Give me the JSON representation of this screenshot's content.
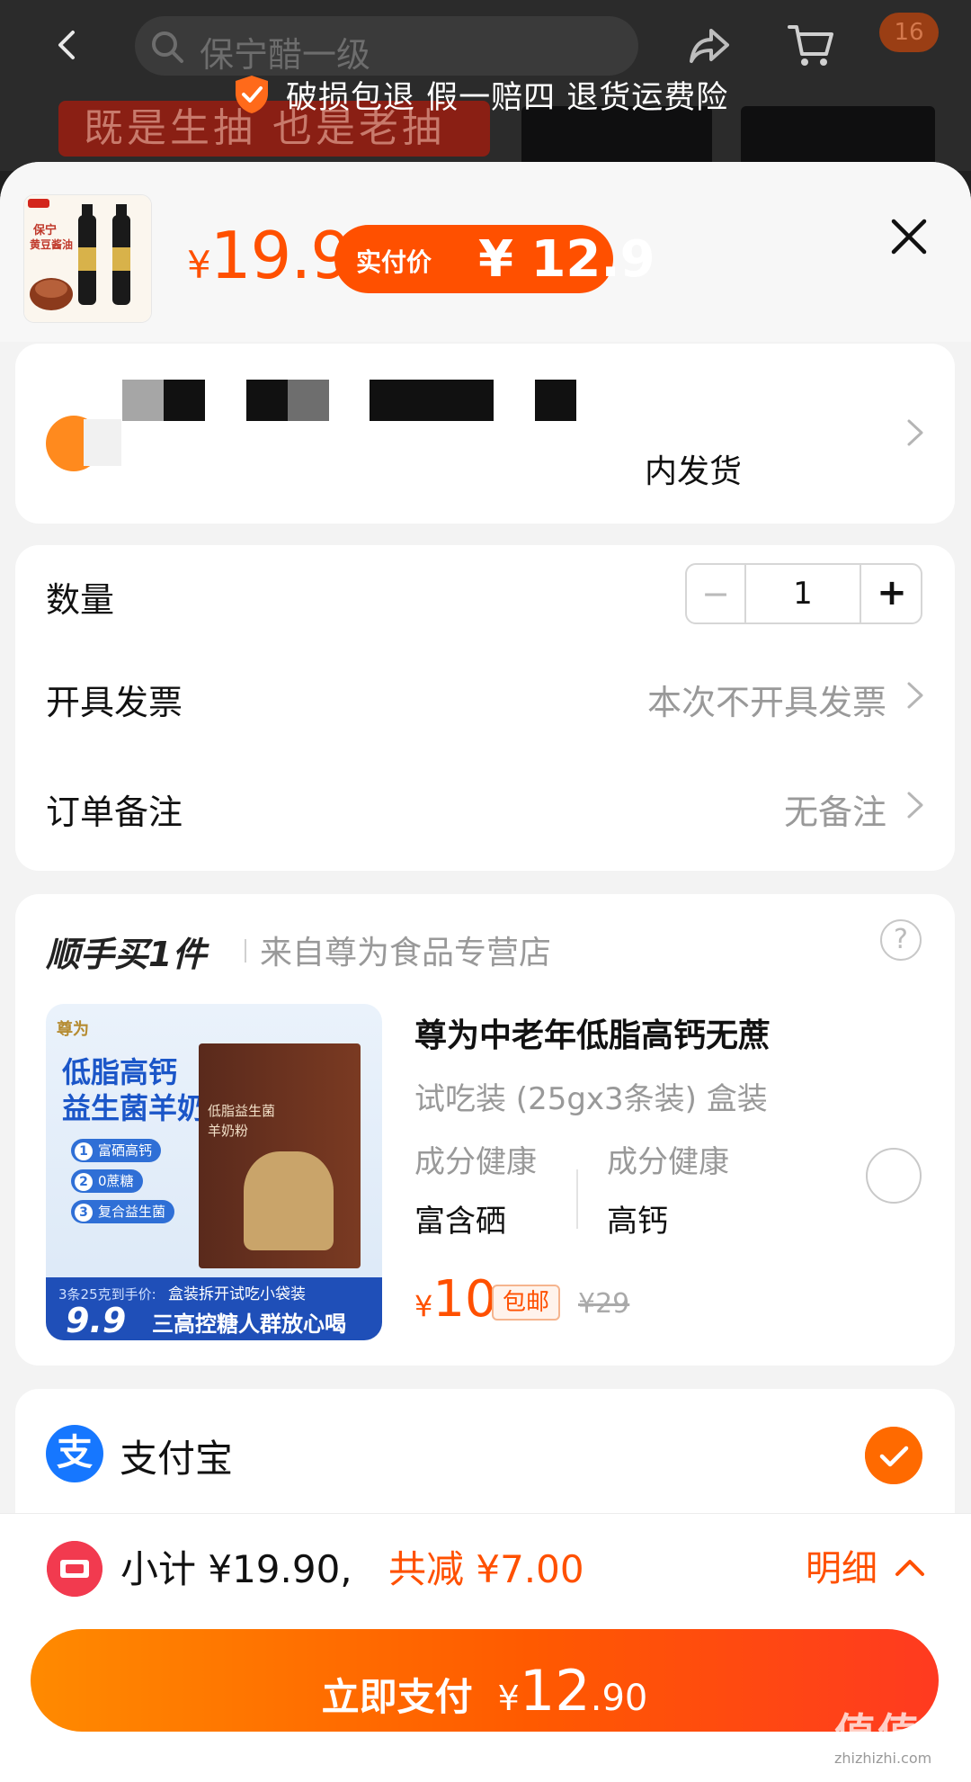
{
  "header": {
    "search_placeholder": "保宁醋一级",
    "cart_badge": "16",
    "guarantee": "破损包退  假一赔四  退货运费险",
    "banner_text": "既是生抽 也是老抽"
  },
  "product": {
    "thumb_brand": "保宁",
    "thumb_title": "黄豆酱油",
    "price_yen": "¥",
    "price": "19.9",
    "actual_label": "实付价",
    "actual_price": "¥ 12.9"
  },
  "address": {
    "shipping_text": "内发货"
  },
  "options": {
    "quantity_label": "数量",
    "quantity_value": "1",
    "minus": "−",
    "plus": "+",
    "invoice_label": "开具发票",
    "invoice_value": "本次不开具发票",
    "note_label": "订单备注",
    "note_value": "无备注"
  },
  "addon": {
    "title": "顺手买1件",
    "store": "来自尊为食品专营店",
    "help": "?",
    "image": {
      "logo": "尊为",
      "headline_1": "低脂高钙",
      "headline_2": "益生菌羊奶粉",
      "features": [
        "富硒高钙",
        "0蔗糖",
        "复合益生菌"
      ],
      "box_title_1": "低脂益生菌",
      "box_title_2": "羊奶粉",
      "promo_small": "3条25克到手价:",
      "promo_big": "9.9",
      "slogan_1": "盒装拆开试吃小袋装",
      "slogan_2": "三高控糖人群放心喝"
    },
    "name": "尊为中老年低脂高钙无蔗",
    "spec": "试吃装 (25gx3条装) 盒装",
    "tags": [
      {
        "label": "成分健康",
        "value": "富含硒"
      },
      {
        "label": "成分健康",
        "value": "高钙"
      }
    ],
    "price_yen": "¥",
    "price": "10",
    "shipping": "包邮",
    "original_price": "¥29"
  },
  "payment": {
    "method": "支付宝",
    "alipay_glyph": "支"
  },
  "summary": {
    "subtotal": "小计 ¥19.90,",
    "discount": "共减 ¥7.00",
    "detail": "明细"
  },
  "pay_button": {
    "label": "立即支付",
    "yen": "¥",
    "int": "12",
    "dec": ".90"
  },
  "watermark": {
    "main": "值值值",
    "site": "zhizhizhi.com"
  },
  "colors": {
    "accent": "#ff5000",
    "alipay": "#1677ff"
  }
}
